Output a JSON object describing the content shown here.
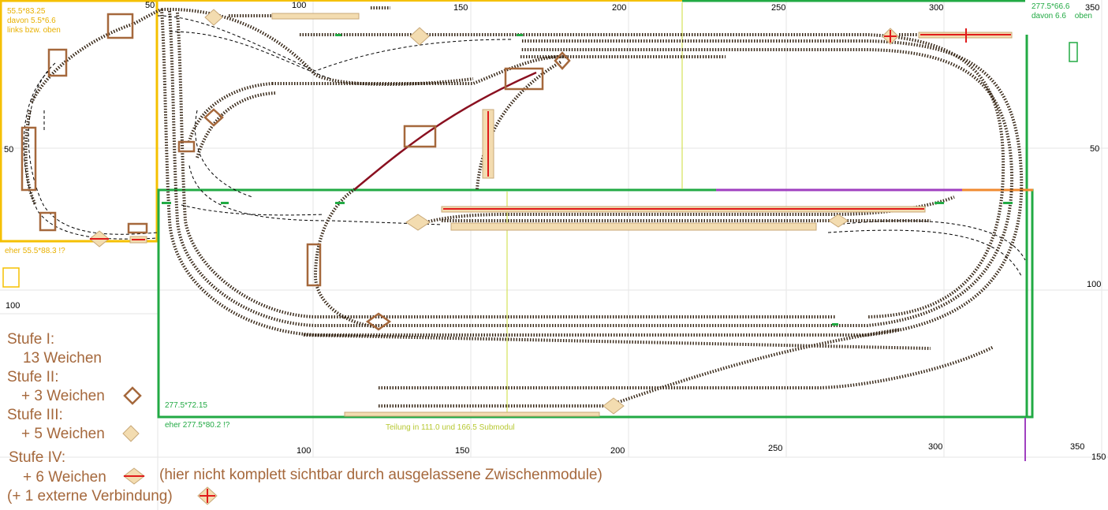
{
  "colors": {
    "module_yellow": "#f5c000",
    "module_green": "#22aa44",
    "module_purple": "#a040c0",
    "module_orange": "#f08a30",
    "grid": "#e6e6e6",
    "track": "#3a2a1a",
    "dashed": "#000000",
    "stage1": "#a5683c",
    "stage3_fill": "#f3dcb0",
    "stage4_red": "#e01b1b",
    "curve_red": "#8a1020",
    "divider": "#cddc39"
  },
  "axis": {
    "top": [
      "50",
      "100",
      "150",
      "200",
      "250",
      "300",
      "350"
    ],
    "bottom": [
      "100",
      "150",
      "200",
      "250",
      "300",
      "350"
    ],
    "left": [
      "50",
      "100"
    ],
    "right": [
      "50",
      "100",
      "150"
    ]
  },
  "modules": {
    "left_module": {
      "size": "55.5*83.25",
      "sub": "davon 5.5*6.6",
      "note": "links bzw. oben",
      "alt": "eher 55.5*88.3 !?"
    },
    "right_module": {
      "size": "277.5*66.6",
      "sub": "davon 6.6",
      "note": "oben"
    },
    "bottom_module": {
      "size": "277.5*72.15",
      "alt": "eher 277.5*80.2 !?"
    },
    "division_note": "Teilung in 111.0 und 166.5 Submodul"
  },
  "legend": {
    "stage1_title": "Stufe I:",
    "stage1_count": "13 Weichen",
    "stage2_title": "Stufe II:",
    "stage2_count": "+ 3 Weichen",
    "stage3_title": "Stufe III:",
    "stage3_count": "+ 5 Weichen",
    "stage4_title": "Stufe IV:",
    "stage4_count": "+ 6 Weichen",
    "stage4_note": "(hier nicht komplett sichtbar durch ausgelassene Zwischenmodule)",
    "external": "(+ 1 externe Verbindung)"
  }
}
